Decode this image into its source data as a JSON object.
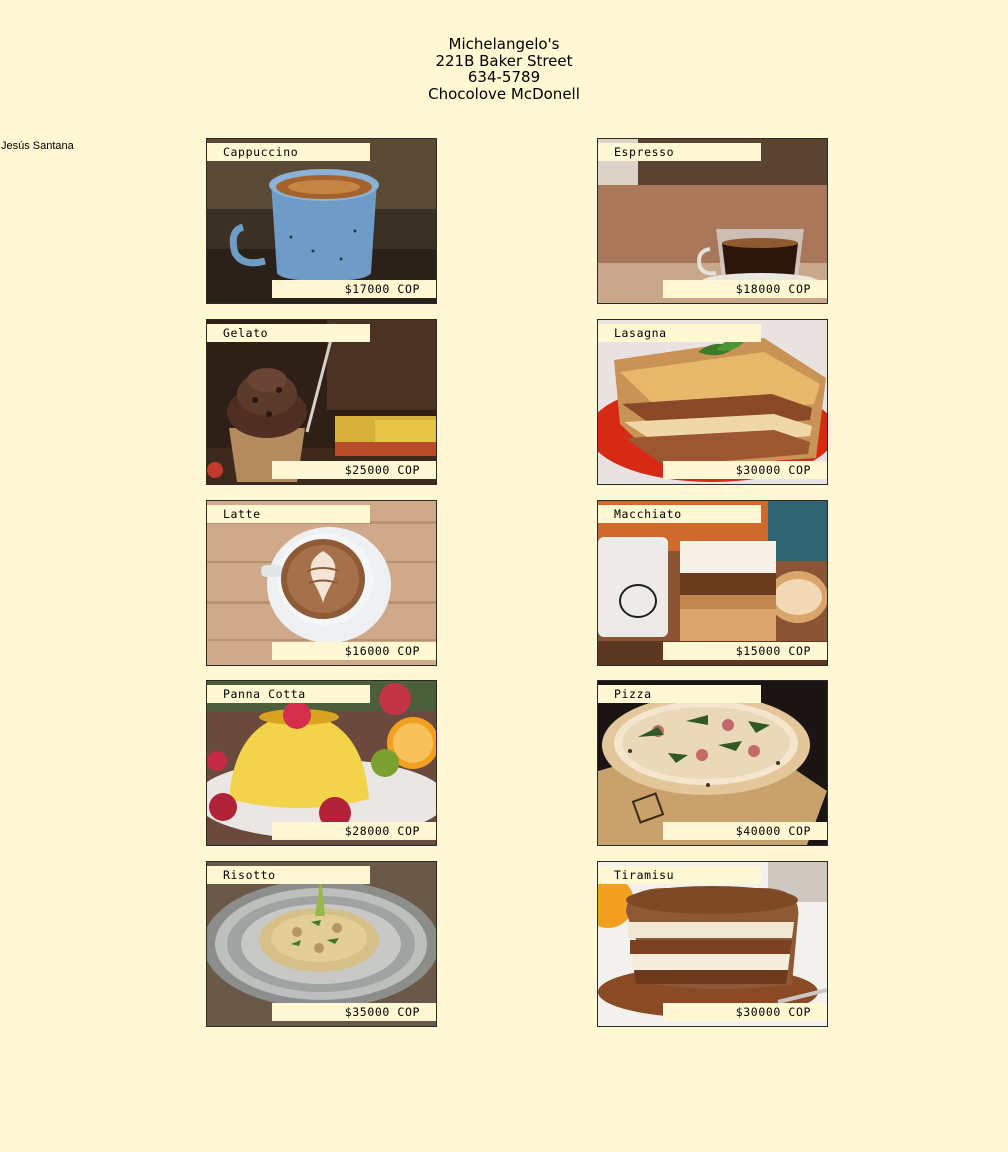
{
  "restaurant": {
    "name": "Michelangelo's",
    "address": "221B Baker Street",
    "phone": "634-5789",
    "owner": "Chocolove McDonell"
  },
  "author": "Jesús Santana",
  "currency": "COP",
  "menu": [
    {
      "name": "Cappuccino",
      "price": "$17000 COP"
    },
    {
      "name": "Espresso",
      "price": "$18000 COP"
    },
    {
      "name": "Gelato",
      "price": "$25000 COP"
    },
    {
      "name": "Lasagna",
      "price": "$30000 COP"
    },
    {
      "name": "Latte",
      "price": "$16000 COP"
    },
    {
      "name": "Macchiato",
      "price": "$15000 COP"
    },
    {
      "name": "Panna Cotta",
      "price": "$28000 COP"
    },
    {
      "name": "Pizza",
      "price": "$40000 COP"
    },
    {
      "name": "Risotto",
      "price": "$35000 COP"
    },
    {
      "name": "Tiramisu",
      "price": "$30000 COP"
    }
  ]
}
